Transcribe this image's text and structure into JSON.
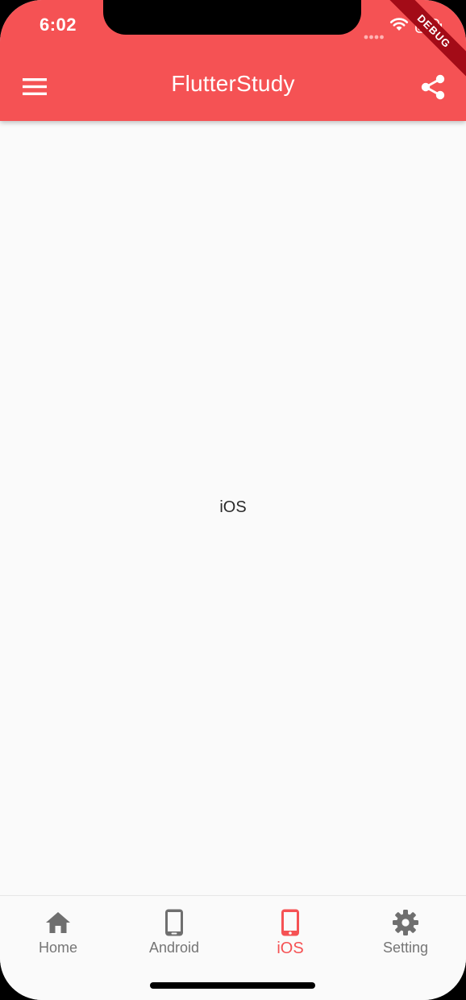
{
  "status_bar": {
    "time": "6:02"
  },
  "debug_banner": "DEBUG",
  "app_bar": {
    "title": "FlutterStudy",
    "background_color": "#f55254",
    "leading_icon": "menu-icon",
    "action_icon": "share-icon"
  },
  "body": {
    "center_text": "iOS"
  },
  "bottom_nav": {
    "active_color": "#f55254",
    "inactive_color": "#757575",
    "items": [
      {
        "label": "Home",
        "icon": "home-icon",
        "active": false
      },
      {
        "label": "Android",
        "icon": "phone-android-icon",
        "active": false
      },
      {
        "label": "iOS",
        "icon": "phone-iphone-icon",
        "active": true
      },
      {
        "label": "Setting",
        "icon": "settings-gear-icon",
        "active": false
      }
    ]
  }
}
